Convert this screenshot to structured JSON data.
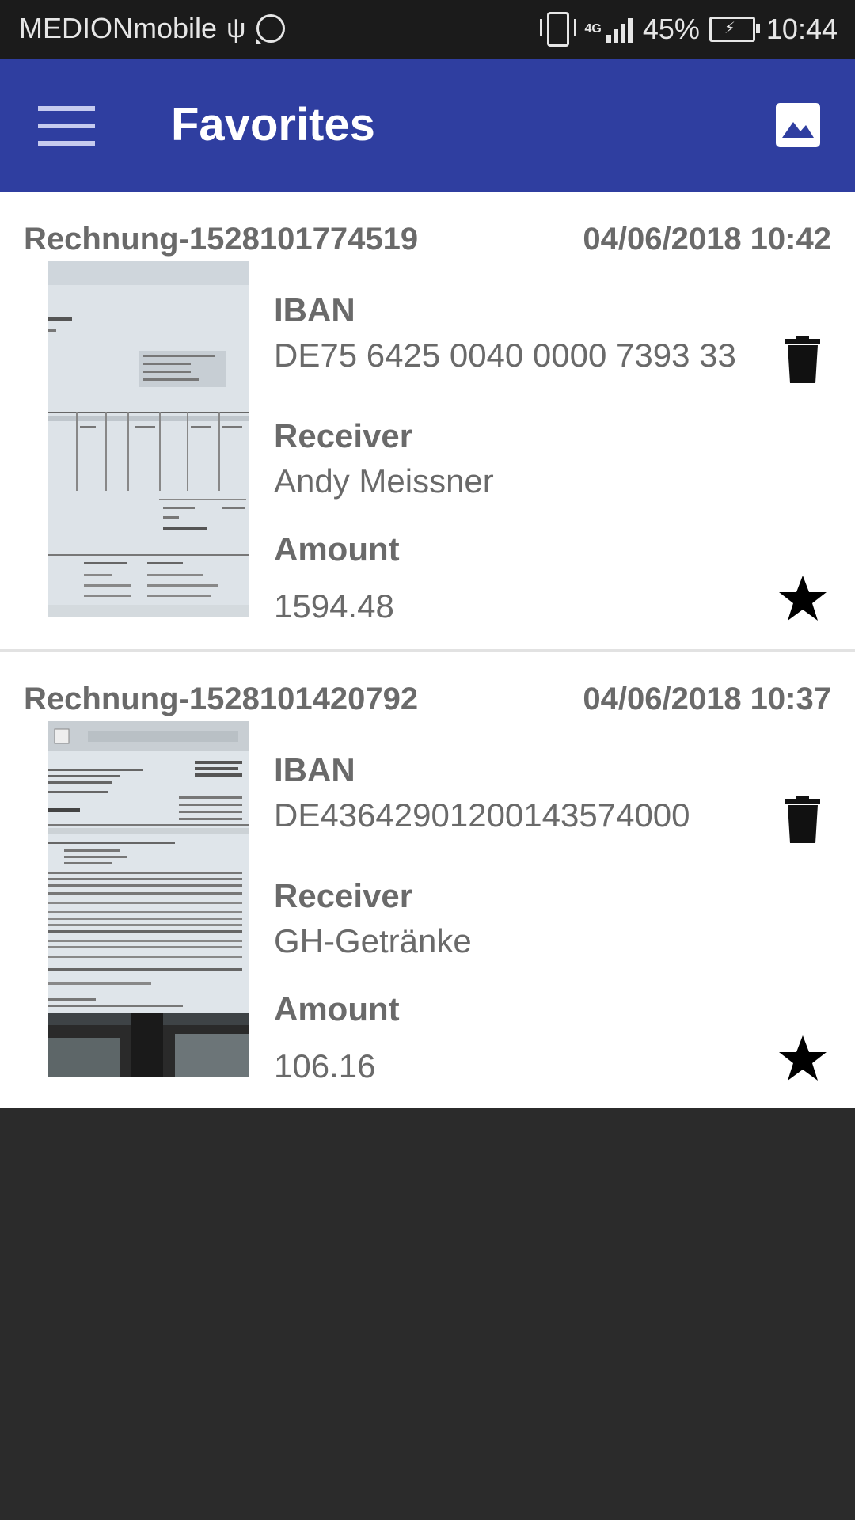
{
  "status_bar": {
    "carrier": "MEDIONmobile",
    "network": "4G",
    "battery": "45%",
    "time": "10:44",
    "icons": [
      "usb-icon",
      "whatsapp-icon",
      "vibrate-icon",
      "signal-icon",
      "battery-charging-icon"
    ]
  },
  "app_bar": {
    "title": "Favorites",
    "menu_icon": "menu-icon",
    "action_icon": "image-icon"
  },
  "colors": {
    "app_bar": "#2f3ea0",
    "status_bar": "#1b1b1b",
    "text": "#6a6a6a",
    "background": "#2b2b2b"
  },
  "labels": {
    "iban": "IBAN",
    "receiver": "Receiver",
    "amount": "Amount"
  },
  "invoices": [
    {
      "name": "Rechnung-1528101774519",
      "date": "04/06/2018 10:42",
      "iban": "DE75 6425 0040 0000 7393 33",
      "receiver": "Andy Meissner",
      "amount": "1594.48"
    },
    {
      "name": "Rechnung-1528101420792",
      "date": "04/06/2018 10:37",
      "iban": "DE43642901200143574000",
      "receiver": "GH-Getränke",
      "amount": "106.16"
    }
  ]
}
